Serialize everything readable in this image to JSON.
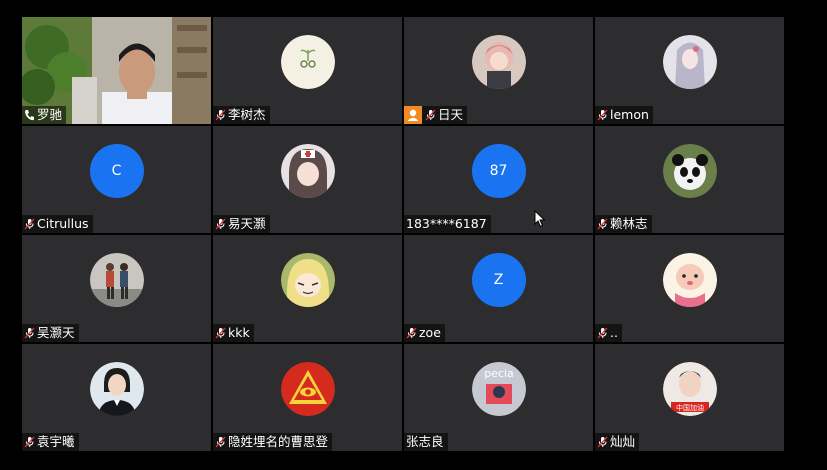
{
  "participants": [
    {
      "name": "罗驰",
      "type": "video",
      "icon": "phone-icon"
    },
    {
      "name": "李树杰",
      "type": "image-avatar",
      "icon": "mute-icon",
      "avatar_icon": "plant-doodle-avatar"
    },
    {
      "name": "日天",
      "type": "image-avatar",
      "icon": "mute-icon",
      "badge": "host-badge",
      "avatar_icon": "anime-girl-avatar"
    },
    {
      "name": "lemon",
      "type": "image-avatar",
      "icon": "mute-icon",
      "avatar_icon": "anime-silver-hair-avatar"
    },
    {
      "name": "Citrullus",
      "type": "letter-avatar",
      "letter": "C",
      "icon": "mute-icon"
    },
    {
      "name": "易天灏",
      "type": "image-avatar",
      "icon": "mute-icon",
      "avatar_icon": "anime-nurse-avatar"
    },
    {
      "name": "183****6187",
      "type": "letter-avatar",
      "letter": "87",
      "icon": "none"
    },
    {
      "name": "赖林志",
      "type": "image-avatar",
      "icon": "mute-icon",
      "avatar_icon": "panda-avatar"
    },
    {
      "name": "吴灏天",
      "type": "image-avatar",
      "icon": "mute-icon",
      "avatar_icon": "two-people-avatar"
    },
    {
      "name": "kkk",
      "type": "image-avatar",
      "icon": "mute-icon",
      "avatar_icon": "anime-blonde-avatar"
    },
    {
      "name": "zoe",
      "type": "letter-avatar",
      "letter": "Z",
      "icon": "mute-icon"
    },
    {
      "name": "..",
      "type": "image-avatar",
      "icon": "mute-icon",
      "avatar_icon": "cartoon-baby-avatar"
    },
    {
      "name": "袁宇曦",
      "type": "image-avatar",
      "icon": "mute-icon",
      "avatar_icon": "portrait-avatar"
    },
    {
      "name": "隐姓埋名的曹思登",
      "type": "image-avatar",
      "icon": "mute-icon",
      "avatar_icon": "eye-pyramid-avatar"
    },
    {
      "name": "张志良",
      "type": "image-avatar",
      "icon": "none",
      "avatar_icon": "special-text-avatar",
      "avatar_text": "pecia"
    },
    {
      "name": "灿灿",
      "type": "image-avatar",
      "icon": "mute-icon",
      "avatar_icon": "china-cheer-avatar",
      "avatar_text": "中国加油"
    }
  ],
  "colors": {
    "tile_bg": "#2d2d2f",
    "letter_avatar_bg": "#1a73f0",
    "host_badge": "#f08a24",
    "active_border": "#2ec27e"
  }
}
